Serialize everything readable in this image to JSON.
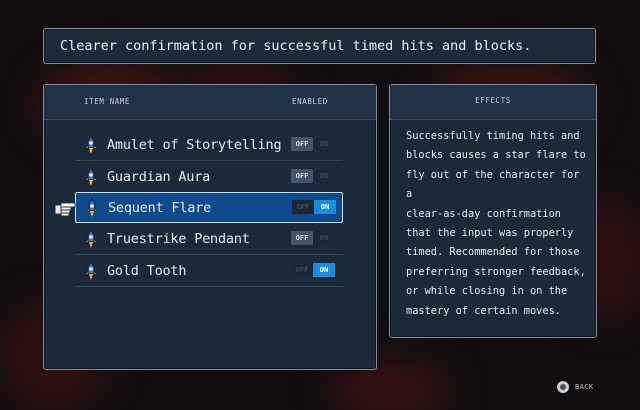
{
  "banner": {
    "text": "Clearer confirmation for successful timed hits and blocks."
  },
  "items_panel": {
    "col_name": "ITEM NAME",
    "col_enabled": "ENABLED",
    "items": [
      {
        "name": "Amulet of Storytelling",
        "enabled": false,
        "selected": false
      },
      {
        "name": "Guardian Aura",
        "enabled": false,
        "selected": false
      },
      {
        "name": "Sequent Flare",
        "enabled": true,
        "selected": true
      },
      {
        "name": "Truestrike Pendant",
        "enabled": false,
        "selected": false
      },
      {
        "name": "Gold Tooth",
        "enabled": true,
        "selected": false
      }
    ],
    "off_label": "OFF",
    "on_label": "ON"
  },
  "effects_panel": {
    "title": "EFFECTS",
    "text": "Successfully timing hits and\nblocks causes a star flare to\nfly out of the character for a\nclear-as-day confirmation\nthat the input was properly\ntimed. Recommended for those\npreferring stronger feedback,\nor while closing in on the\nmastery of certain moves."
  },
  "footer": {
    "back_label": "BACK",
    "back_icon": "circle-button-icon"
  },
  "colors": {
    "panel": "#1c2939",
    "border": "#7d8fa6",
    "selected": "#0e4a8c",
    "toggle_on": "#1a8be0"
  }
}
